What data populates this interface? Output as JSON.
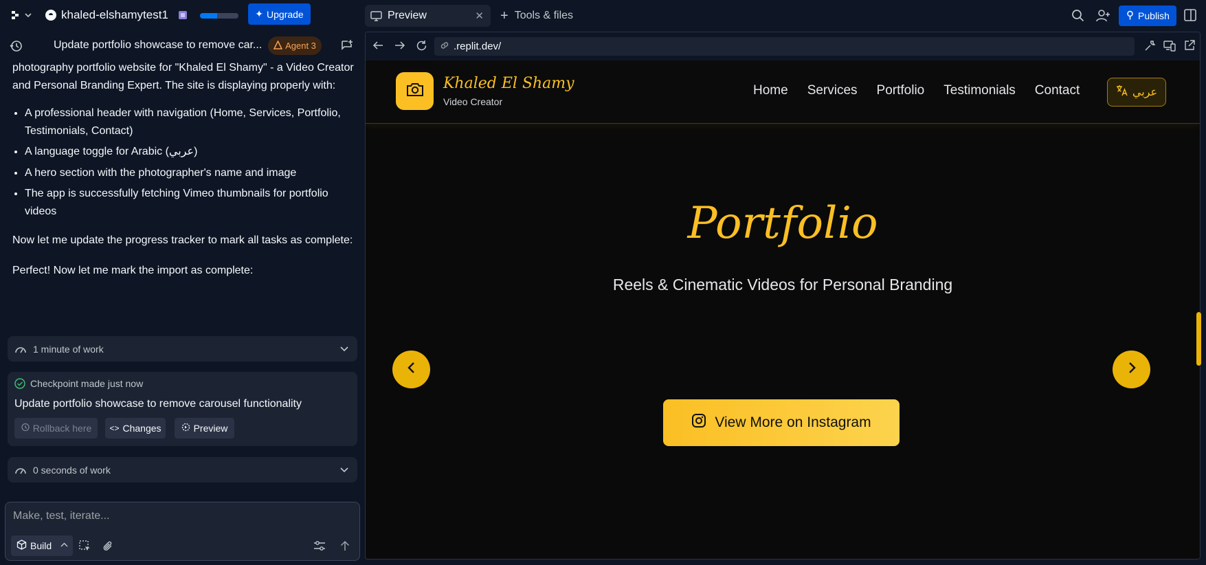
{
  "topbar": {
    "project_name": "khaled-elshamytest1",
    "upgrade_label": "Upgrade",
    "progress": 0.45,
    "preview_tab_label": "Preview",
    "tools_tab_label": "Tools & files",
    "publish_label": "Publish"
  },
  "chat": {
    "title": "Update portfolio showcase to remove car...",
    "agent_badge": "Agent 3",
    "intro": "photography portfolio website for \"Khaled El Shamy\" - a Video Creator and Personal Branding Expert. The site is displaying properly with:",
    "bullets": [
      "A professional header with navigation (Home, Services, Portfolio, Testimonials, Contact)",
      "A language toggle for Arabic (عربي)",
      "A hero section with the photographer's name and image",
      "The app is successfully fetching Vimeo thumbnails for portfolio videos"
    ],
    "para2": "Now let me update the progress tracker to mark all tasks as complete:",
    "para3": "Perfect! Now let me mark the import as complete:",
    "work1": "1 minute of work",
    "checkpoint_status": "Checkpoint made just now",
    "checkpoint_title": "Update portfolio showcase to remove carousel functionality",
    "rollback_label": "Rollback here",
    "changes_label": "Changes",
    "preview_label": "Preview",
    "work2": "0 seconds of work",
    "input_placeholder": "Make, test, iterate...",
    "build_label": "Build"
  },
  "browser": {
    "url": ".replit.dev/"
  },
  "site": {
    "brand_name": "Khaled El Shamy",
    "brand_sub": "Video Creator",
    "nav": [
      "Home",
      "Services",
      "Portfolio",
      "Testimonials",
      "Contact"
    ],
    "lang_label": "عربي",
    "hero_title": "Portfolio",
    "hero_sub": "Reels & Cinematic Videos for Personal Branding",
    "insta_label": "View More on Instagram"
  },
  "colors": {
    "accent_blue": "#0053d6",
    "gold": "#fbbf24",
    "agent_orange": "#f9a252",
    "bg": "#0e1525"
  }
}
